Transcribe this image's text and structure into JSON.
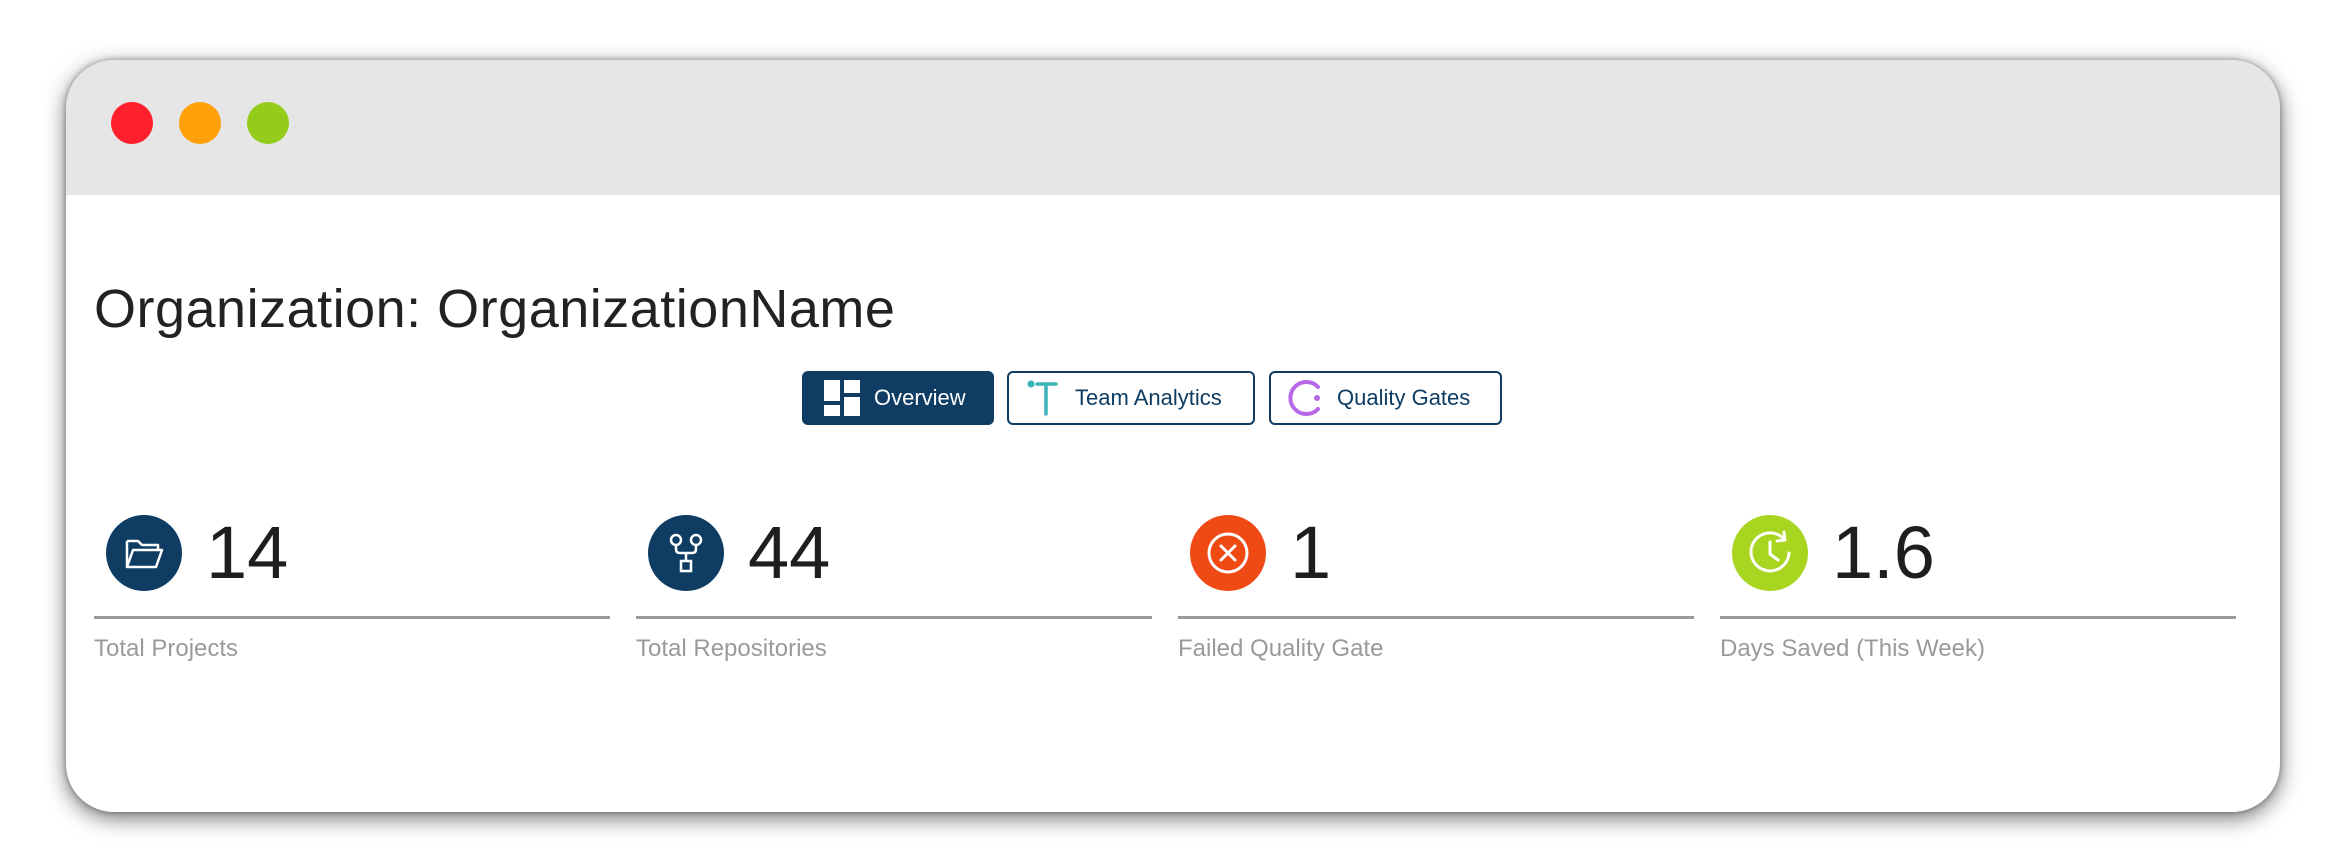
{
  "colors": {
    "titlebar": "#e6e6e6",
    "close": "#ff1f2d",
    "minimize": "#ff9f0a",
    "maximize": "#94cc1b",
    "primary": "#0e3c62",
    "team_icon": "#3bb3b8",
    "quality_icon": "#b768e6",
    "failed": "#f04a14",
    "saved": "#a8d51f",
    "rule": "#9a9a9a"
  },
  "header": {
    "title": "Organization: OrganizationName"
  },
  "tabs": [
    {
      "label": "Overview",
      "icon": "dashboard-grid-icon",
      "active": true
    },
    {
      "label": "Team Analytics",
      "icon": "team-analytics-icon",
      "active": false
    },
    {
      "label": "Quality Gates",
      "icon": "quality-gate-icon",
      "active": false
    }
  ],
  "stats": [
    {
      "value": "14",
      "label": "Total Projects",
      "icon": "folder-icon"
    },
    {
      "value": "44",
      "label": "Total Repositories",
      "icon": "repository-branch-icon"
    },
    {
      "value": "1",
      "label": "Failed Quality Gate",
      "icon": "failed-x-icon"
    },
    {
      "value": "1.6",
      "label": "Days Saved (This Week)",
      "icon": "clock-icon"
    }
  ]
}
